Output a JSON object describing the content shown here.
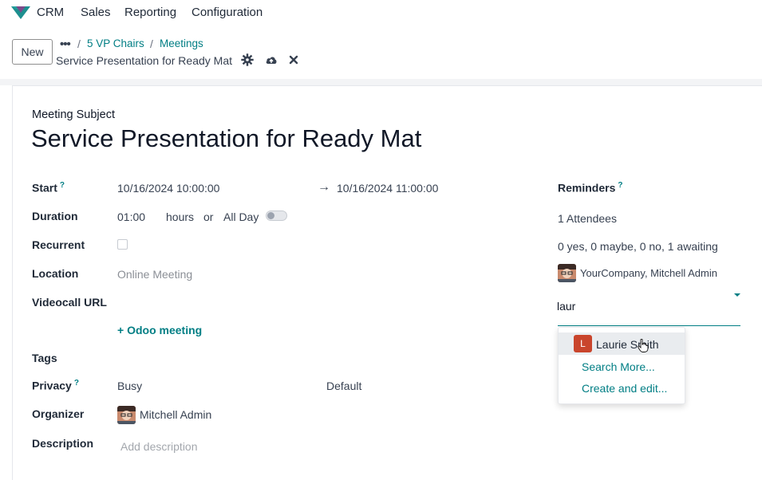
{
  "navbar": {
    "app_name": "CRM",
    "menu": [
      "Sales",
      "Reporting",
      "Configuration"
    ]
  },
  "control_panel": {
    "new_label": "New",
    "breadcrumb_dots": "•••",
    "breadcrumb": [
      "5 VP Chairs",
      "Meetings"
    ],
    "current_record": "Service Presentation for Ready Mat"
  },
  "form": {
    "subject_label": "Meeting Subject",
    "subject": "Service Presentation for Ready Mat",
    "start_label": "Start",
    "start_help": "?",
    "start_value": "10/16/2024 10:00:00",
    "end_arrow": "→",
    "end_value": "10/16/2024 11:00:00",
    "duration_label": "Duration",
    "duration_value": "01:00",
    "duration_unit": "hours",
    "duration_or": "or",
    "allday_label": "All Day",
    "allday_checked": false,
    "recurrent_label": "Recurrent",
    "recurrent_checked": false,
    "location_label": "Location",
    "location_value": "Online Meeting",
    "videocall_label": "Videocall URL",
    "odoo_meeting_label": "Odoo meeting",
    "tags_label": "Tags",
    "privacy_label": "Privacy",
    "privacy_help": "?",
    "privacy_value": "Busy",
    "privacy_default": "Default",
    "organizer_label": "Organizer",
    "organizer_value": "Mitchell Admin",
    "description_label": "Description",
    "description_placeholder": "Add description"
  },
  "right": {
    "reminders_label": "Reminders",
    "reminders_help": "?",
    "attendees_count": "1 Attendees",
    "attendance_summary": "0 yes, 0 maybe, 0 no, 1 awaiting",
    "attendee_name": "YourCompany, Mitchell Admin",
    "attendee_input_value": "laur",
    "dropdown": {
      "badge_letter": "L",
      "suggestion": "Laurie Smith",
      "search_more": "Search More...",
      "create_edit": "Create and edit..."
    }
  },
  "colors": {
    "accent": "#017e84",
    "badge": "#c9452c"
  }
}
